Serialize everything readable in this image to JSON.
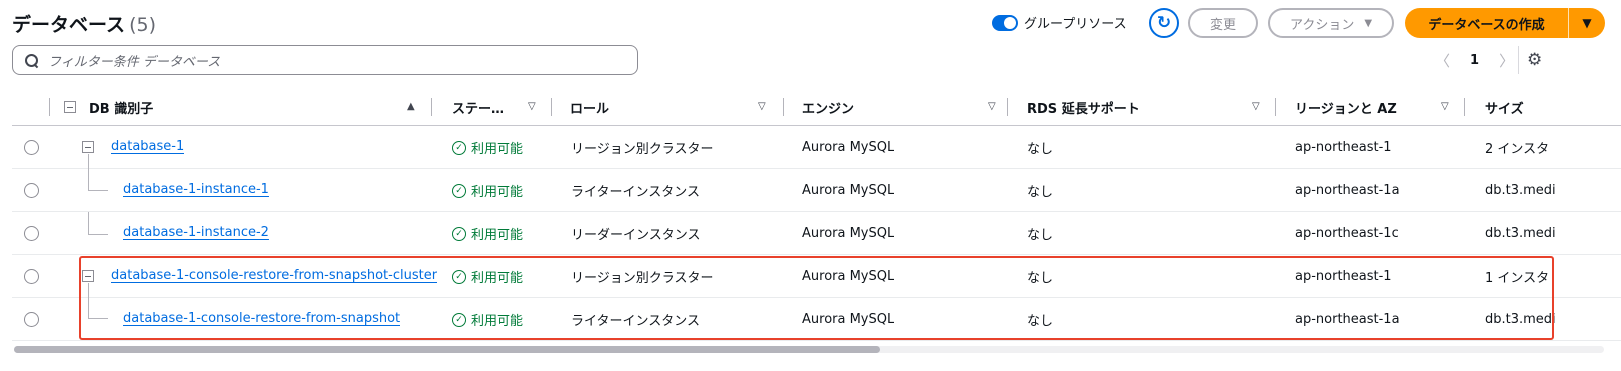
{
  "header": {
    "title": "データベース",
    "count": "(5)",
    "group_toggle_label": "グループリソース",
    "modify_label": "変更",
    "actions_label": "アクション",
    "create_label": "データベースの作成"
  },
  "filter": {
    "placeholder": "フィルター条件 データベース"
  },
  "pagination": {
    "current_page": "1"
  },
  "table": {
    "columns": {
      "db_identifier": "DB 識別子",
      "status": "ステー…",
      "role": "ロール",
      "engine": "エンジン",
      "rds_extended_support": "RDS 延長サポート",
      "region_az": "リージョンと AZ",
      "size": "サイズ"
    },
    "rows": [
      {
        "id": "database-1",
        "status": "利用可能",
        "role": "リージョン別クラスター",
        "engine": "Aurora MySQL",
        "extended_support": "なし",
        "region": "ap-northeast-1",
        "size": "2 インスタ"
      },
      {
        "id": "database-1-instance-1",
        "status": "利用可能",
        "role": "ライターインスタンス",
        "engine": "Aurora MySQL",
        "extended_support": "なし",
        "region": "ap-northeast-1a",
        "size": "db.t3.medi"
      },
      {
        "id": "database-1-instance-2",
        "status": "利用可能",
        "role": "リーダーインスタンス",
        "engine": "Aurora MySQL",
        "extended_support": "なし",
        "region": "ap-northeast-1c",
        "size": "db.t3.medi"
      },
      {
        "id": "database-1-console-restore-from-snapshot-cluster",
        "status": "利用可能",
        "role": "リージョン別クラスター",
        "engine": "Aurora MySQL",
        "extended_support": "なし",
        "region": "ap-northeast-1",
        "size": "1 インスタ"
      },
      {
        "id": "database-1-console-restore-from-snapshot",
        "status": "利用可能",
        "role": "ライターインスタンス",
        "engine": "Aurora MySQL",
        "extended_support": "なし",
        "region": "ap-northeast-1a",
        "size": "db.t3.medi"
      }
    ]
  },
  "colors": {
    "primary_button": "#ff9900",
    "link": "#006ce0",
    "status_ok": "#007a38",
    "highlight": "#e8412b"
  },
  "icons": {
    "search": "search-icon",
    "refresh": "refresh-icon",
    "settings": "gear-icon",
    "status": "check-circle-icon"
  }
}
